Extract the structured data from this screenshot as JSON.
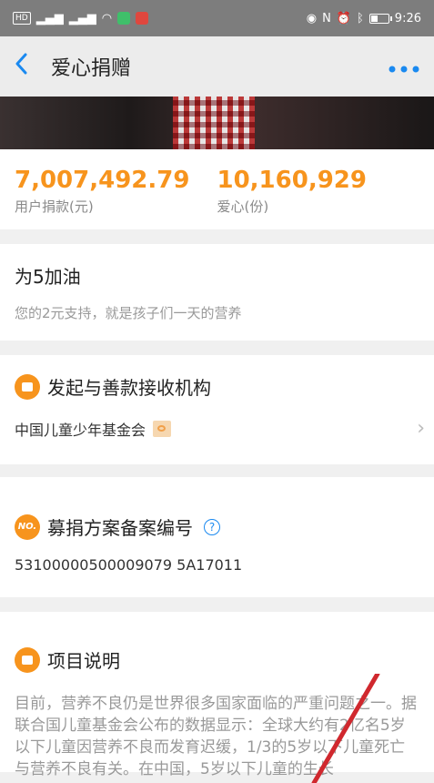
{
  "status_bar": {
    "left_chips": [
      "HD",
      "4G",
      "3G"
    ],
    "time": "9:26",
    "battery_level": 0.45
  },
  "nav": {
    "title": "爱心捐赠",
    "back_icon": "chevron-left-icon",
    "more_icon": "more-dots-icon"
  },
  "stats": {
    "donation_amount": "7,007,492.79",
    "donation_label": "用户捐款(元)",
    "hearts_count": "10,160,929",
    "hearts_label": "爱心(份)"
  },
  "cheer": {
    "title": "为5加油",
    "subtitle": "您的2元支持，就是孩子们一天的营养"
  },
  "organization": {
    "title": "发起与善款接收机构",
    "name": "中国儿童少年基金会"
  },
  "registration": {
    "title": "募捐方案备案编号",
    "badge": "NO.",
    "number": "53100000500009079 5A17011"
  },
  "description": {
    "title": "项目说明",
    "text": "目前，营养不良仍是世界很多国家面临的严重问题之一。据联合国儿童基金会公布的数据显示：全球大约有2亿名5岁以下儿童因营养不良而发育迟缓，1/3的5岁以下儿童死亡与营养不良有关。在中国，5岁以下儿童的生长"
  },
  "colors": {
    "accent": "#f7941d",
    "link": "#1a89f0"
  }
}
